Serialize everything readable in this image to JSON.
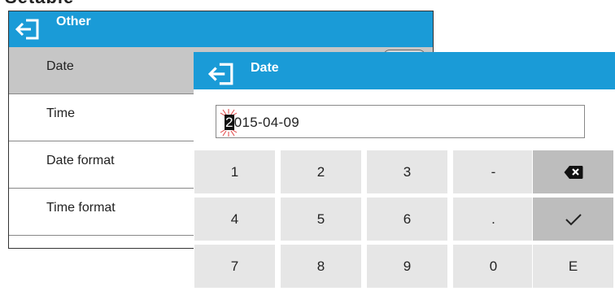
{
  "clipped_top_text": "Setable",
  "back_window": {
    "title": "Other",
    "items": [
      {
        "label": "Date",
        "selected": true
      },
      {
        "label": "Time"
      },
      {
        "label": "Date format"
      },
      {
        "label": "Time format"
      }
    ]
  },
  "dialog": {
    "title": "Date",
    "value": "2015-04-09",
    "value_first_char": "2",
    "value_rest": "015-04-09"
  },
  "keypad": {
    "rows": [
      [
        "1",
        "2",
        "3",
        "-",
        "backspace"
      ],
      [
        "4",
        "5",
        "6",
        ".",
        "enter"
      ],
      [
        "7",
        "8",
        "9",
        "0",
        "E"
      ]
    ]
  },
  "icons": {
    "back": "exit-arrow-icon",
    "backspace": "backspace-icon",
    "enter": "checkmark-icon"
  },
  "colors": {
    "header": "#1a9bd7",
    "selected_row": "#c6c6c6",
    "key": "#e6e6e6",
    "key_dark": "#bdbdbd"
  }
}
